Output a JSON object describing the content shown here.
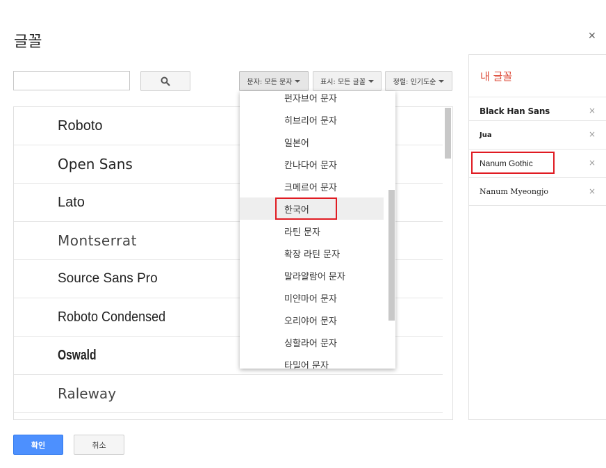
{
  "dialog": {
    "title": "글꼴",
    "close_icon": "close-icon"
  },
  "search": {
    "value": "",
    "placeholder": "",
    "button_icon": "search-icon"
  },
  "filters": [
    {
      "label": "문자: 모든 문자"
    },
    {
      "label": "표시: 모든 글꼴"
    },
    {
      "label": "정렬: 인기도순"
    }
  ],
  "font_list": [
    {
      "name": "Roboto"
    },
    {
      "name": "Open Sans"
    },
    {
      "name": "Lato"
    },
    {
      "name": "Montserrat"
    },
    {
      "name": "Source Sans Pro"
    },
    {
      "name": "Roboto Condensed"
    },
    {
      "name": "Oswald"
    },
    {
      "name": "Raleway"
    }
  ],
  "script_dropdown": {
    "items": [
      "펀자브어 문자",
      "히브리어 문자",
      "일본어",
      "칸나다어 문자",
      "크메르어 문자",
      "한국어",
      "라틴 문자",
      "확장 라틴 문자",
      "말라얄람어 문자",
      "미얀마어 문자",
      "오리야어 문자",
      "싱할라어 문자",
      "타밀어 문자"
    ],
    "selected": "한국어"
  },
  "my_fonts": {
    "title": "내 글꼴",
    "items": [
      {
        "name": "Black Han Sans"
      },
      {
        "name": "Jua"
      },
      {
        "name": "Nanum Gothic"
      },
      {
        "name": "Nanum Myeongjo"
      }
    ],
    "remove_icon": "×"
  },
  "buttons": {
    "ok": "확인",
    "cancel": "취소"
  },
  "colors": {
    "accent": "#4d90fe",
    "panel_title": "#dd4b39",
    "highlight_box": "#e01b22"
  }
}
